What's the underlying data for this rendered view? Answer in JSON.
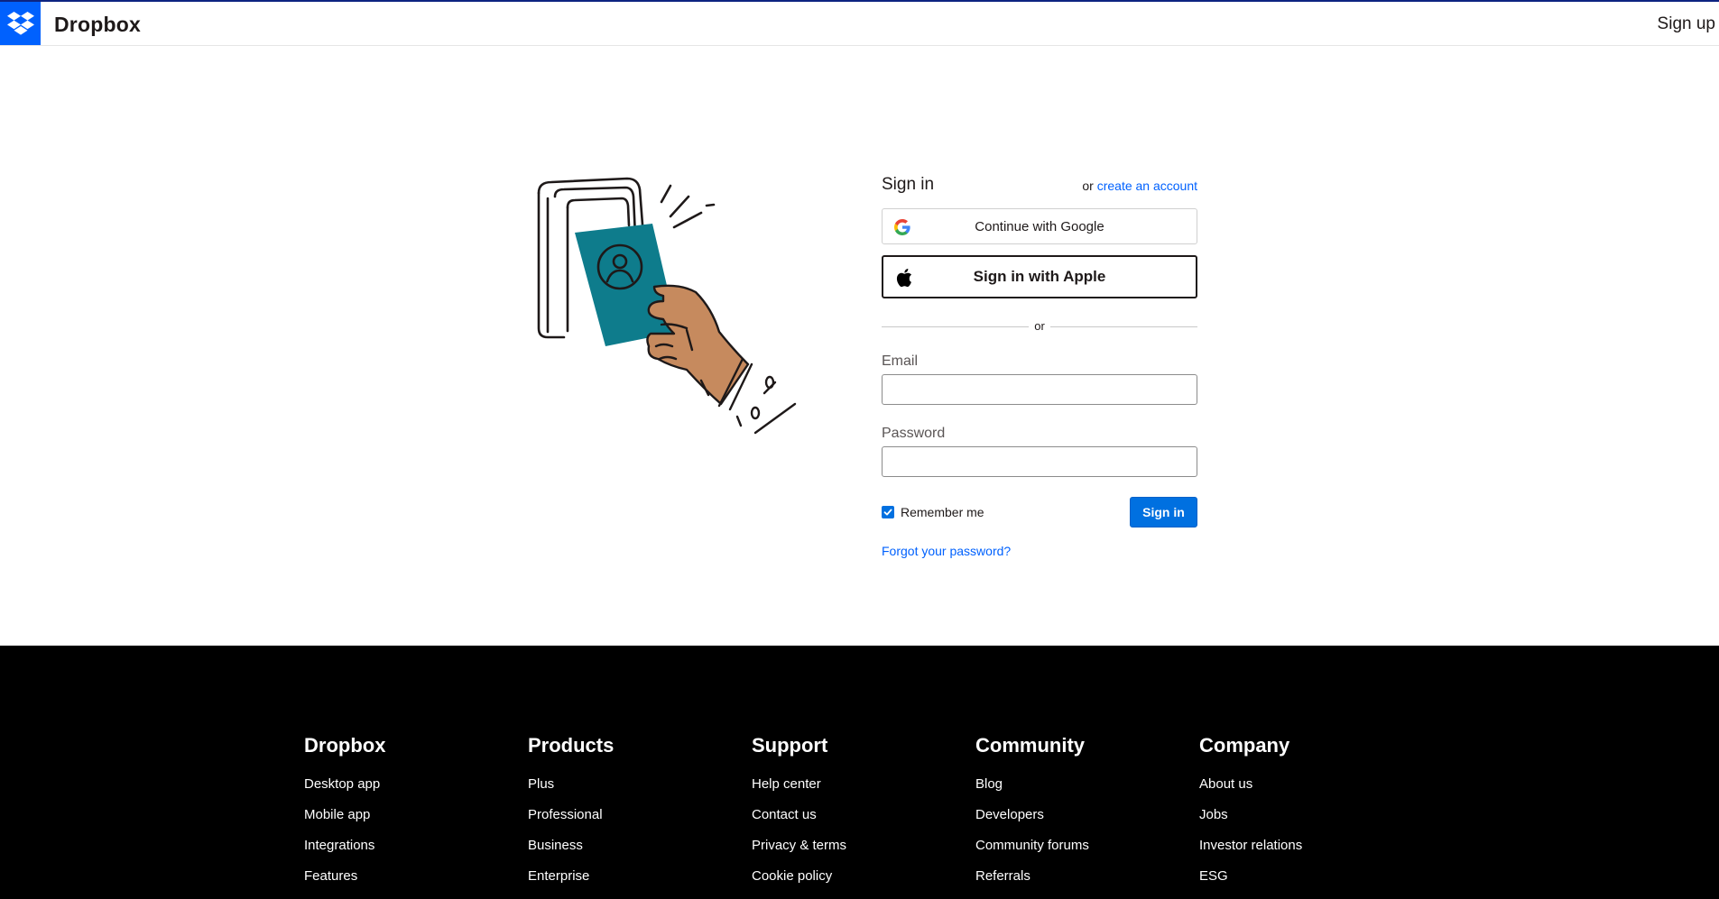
{
  "header": {
    "brand": "Dropbox",
    "signup_label": "Sign up",
    "accent_color": "#0061fe"
  },
  "login": {
    "title": "Sign in",
    "alt_prefix": "or",
    "alt_link": "create an account",
    "google_label": "Continue with Google",
    "apple_label": "Sign in with Apple",
    "divider_text": "or",
    "email_label": "Email",
    "email_value": "",
    "password_label": "Password",
    "password_value": "",
    "remember_label": "Remember me",
    "remember_checked": true,
    "signin_label": "Sign in",
    "forgot_label": "Forgot your password?",
    "button_color": "#0070e0"
  },
  "illustration": {
    "icon": "hand-holding-id-card-illustration",
    "card_color": "#0e7c8c",
    "skin_color": "#c68a5e"
  },
  "footer": {
    "columns": [
      {
        "heading": "Dropbox",
        "links": [
          "Desktop app",
          "Mobile app",
          "Integrations",
          "Features"
        ]
      },
      {
        "heading": "Products",
        "links": [
          "Plus",
          "Professional",
          "Business",
          "Enterprise"
        ]
      },
      {
        "heading": "Support",
        "links": [
          "Help center",
          "Contact us",
          "Privacy & terms",
          "Cookie policy"
        ]
      },
      {
        "heading": "Community",
        "links": [
          "Blog",
          "Developers",
          "Community forums",
          "Referrals"
        ]
      },
      {
        "heading": "Company",
        "links": [
          "About us",
          "Jobs",
          "Investor relations",
          "ESG"
        ]
      }
    ]
  }
}
